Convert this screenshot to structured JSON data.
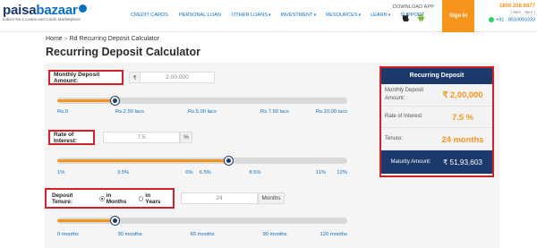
{
  "brand": {
    "logo_part1": "paisa",
    "logo_part2": "bazaar",
    "tagline": "India's No.1 Loans and Cards Marketplace",
    "primary_color": "#1b3a6b",
    "accent_color": "#f7941d",
    "link_color": "#0a6fc2",
    "highlight_border": "#d21f28"
  },
  "nav": {
    "items": [
      {
        "label": "CREDIT CARDS",
        "caret": ""
      },
      {
        "label": "PERSONAL LOAN",
        "caret": ""
      },
      {
        "label": "OTHER LOANS",
        "caret": "▾"
      },
      {
        "label": "INVESTMENT",
        "caret": "▾"
      },
      {
        "label": "RESOURCES",
        "caret": "▾"
      },
      {
        "label": "LEARN",
        "caret": "▾"
      },
      {
        "label": "SUPPORT",
        "caret": ""
      }
    ],
    "download_label": "DOWNLOAD APP",
    "store_icons": [
      "apple-icon",
      "android-icon"
    ],
    "signin_label": "Sign In",
    "phone": "1800 208 8877",
    "hours": "( 9am - 9pm )",
    "whatsapp": "+91 - 8510093333"
  },
  "breadcrumb": {
    "home": "Home",
    "separator": "»",
    "current": "Rd Recurring Deposit Calculator"
  },
  "page_title": "Recurring Deposit Calculator",
  "calculator": {
    "deposit": {
      "label": "Monthly Deposit Amount:",
      "currency": "₹",
      "value": "2,00,000",
      "slider_fraction": 0.2,
      "ticks": [
        "Rs.0",
        "Rs.2.50 lacs",
        "Rs.5.00 lacs",
        "Rs.7.50 lacs",
        "Rs.10.00 lacs"
      ]
    },
    "rate": {
      "label": "Rate of Interest:",
      "value": "7.5",
      "unit": "%",
      "slider_fraction": 0.59,
      "ticks": [
        "1%",
        "3.5%",
        "6%",
        "6.5%",
        "8.5%",
        "11%",
        "12%"
      ]
    },
    "tenure": {
      "label": "Deposit Tenure:",
      "option_months": "in Months",
      "option_years": "in Years",
      "selected": "months",
      "value": "24",
      "unit": "Months",
      "slider_fraction": 0.2,
      "ticks": [
        "0 months",
        "30 months",
        "60 months",
        "90 months",
        "120 months"
      ]
    }
  },
  "result": {
    "title": "Recurring Deposit",
    "rows": [
      {
        "label": "Monthly Deposit Amount:",
        "value": "₹ 2,00,000"
      },
      {
        "label": "Rate of Interest:",
        "value": "7.5 %"
      },
      {
        "label": "Tenure:",
        "value": "24 months"
      }
    ],
    "maturity_label": "Maturity Amount:",
    "maturity_value": "₹ 51,93,603"
  }
}
